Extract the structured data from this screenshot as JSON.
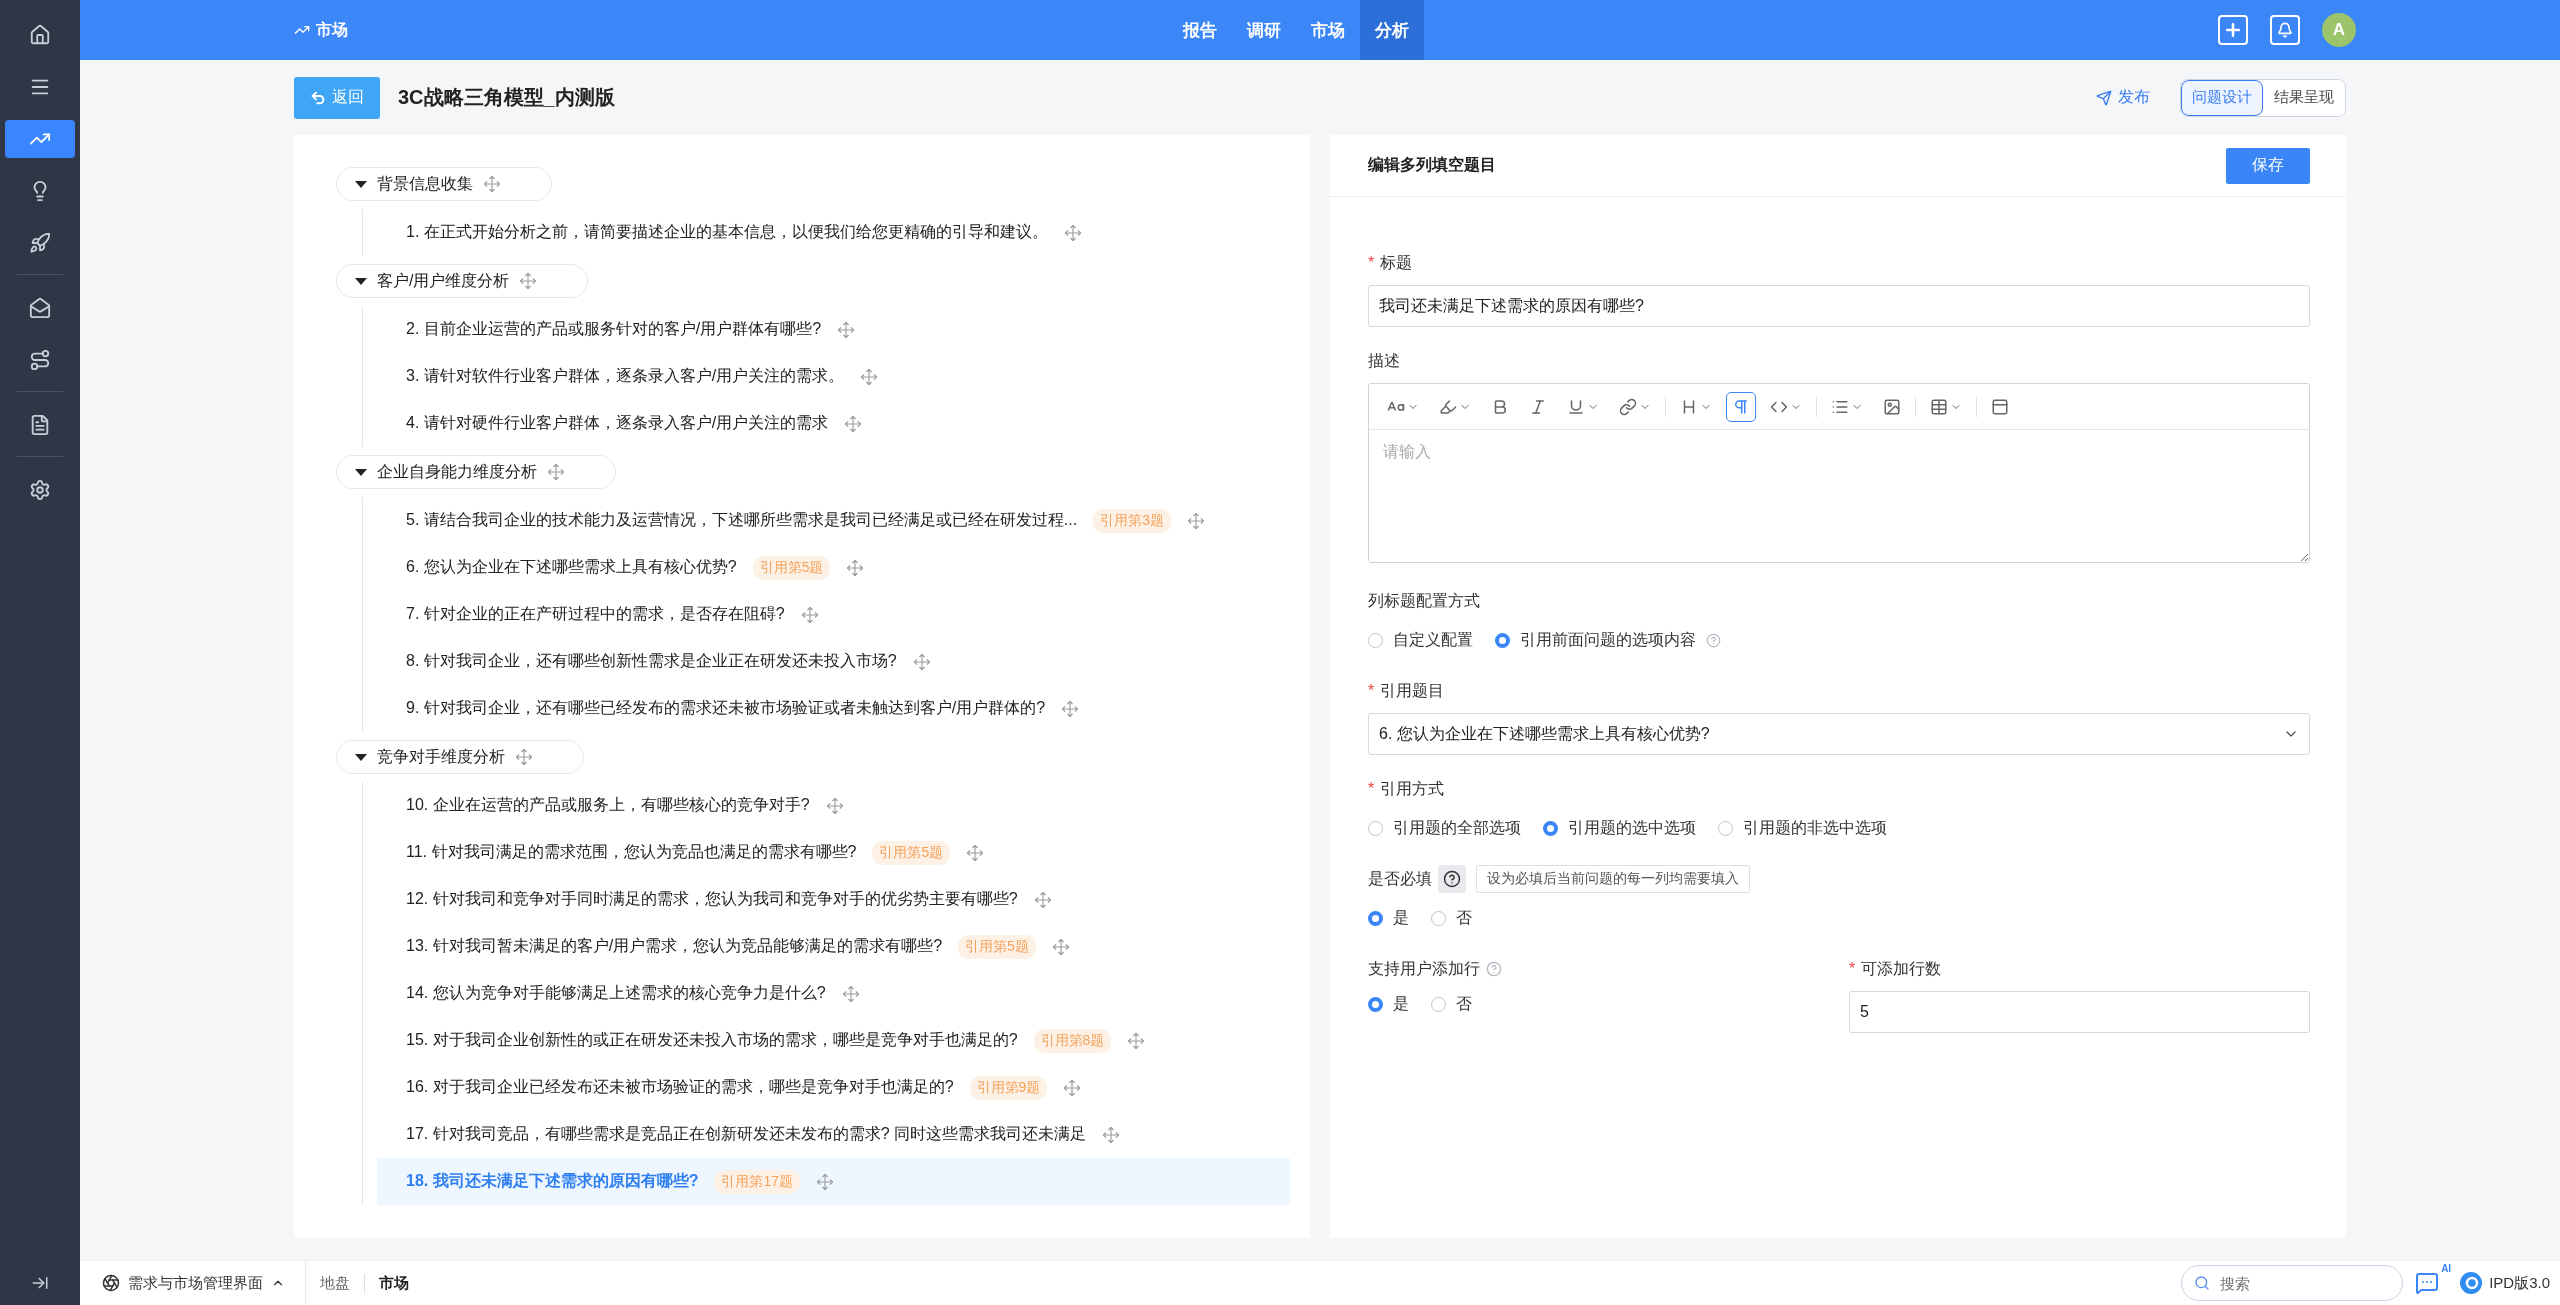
{
  "sidebar": {
    "groups": [
      [
        {
          "selected": false
        },
        {
          "selected": false
        },
        {
          "selected": true
        },
        {
          "selected": false
        },
        {
          "selected": false
        }
      ],
      [
        {
          "selected": false
        },
        {
          "selected": false
        }
      ],
      [
        {
          "selected": false
        }
      ],
      [
        {
          "selected": false
        }
      ]
    ]
  },
  "topbar": {
    "brand": "市场",
    "tabs": [
      {
        "label": "报告",
        "selected": false
      },
      {
        "label": "调研",
        "selected": false
      },
      {
        "label": "市场",
        "selected": false
      },
      {
        "label": "分析",
        "selected": true
      }
    ],
    "avatar": "A"
  },
  "header": {
    "back": "返回",
    "title": "3C战略三角模型_内测版",
    "publish": "发布",
    "views": [
      {
        "label": "问题设计",
        "selected": true
      },
      {
        "label": "结果呈现",
        "selected": false
      }
    ]
  },
  "outline": {
    "sections": [
      {
        "title": "背景信息收集",
        "expanded": true,
        "children": [
          {
            "text": "1. 在正式开始分析之前，请简要描述企业的基本信息，以便我们给您更精确的引导和建议。",
            "selected": false
          }
        ]
      },
      {
        "title": "客户/用户维度分析",
        "expanded": true,
        "children": [
          {
            "text": "2. 目前企业运营的产品或服务针对的客户/用户群体有哪些?",
            "selected": false
          },
          {
            "text": "3. 请针对软件行业客户群体，逐条录入客户/用户关注的需求。",
            "selected": false
          },
          {
            "text": "4. 请针对硬件行业客户群体，逐条录入客户/用户关注的需求",
            "selected": false
          }
        ]
      },
      {
        "title": "企业自身能力维度分析",
        "expanded": true,
        "children": [
          {
            "text": "5. 请结合我司企业的技术能力及运营情况，下述哪所些需求是我司已经满足或已经在研发过程...",
            "ref": "引用第3题",
            "selected": false
          },
          {
            "text": "6. 您认为企业在下述哪些需求上具有核心优势?",
            "ref": "引用第5题",
            "selected": false
          },
          {
            "text": "7. 针对企业的正在产研过程中的需求，是否存在阻碍?",
            "selected": false
          },
          {
            "text": "8. 针对我司企业，还有哪些创新性需求是企业正在研发还未投入市场?",
            "selected": false
          },
          {
            "text": "9. 针对我司企业，还有哪些已经发布的需求还未被市场验证或者未触达到客户/用户群体的?",
            "selected": false
          }
        ]
      },
      {
        "title": "竞争对手维度分析",
        "expanded": true,
        "children": [
          {
            "text": "10. 企业在运营的产品或服务上，有哪些核心的竞争对手?",
            "selected": false
          },
          {
            "text": "11. 针对我司满足的需求范围，您认为竞品也满足的需求有哪些?",
            "ref": "引用第5题",
            "selected": false
          },
          {
            "text": "12. 针对我司和竞争对手同时满足的需求，您认为我司和竞争对手的优劣势主要有哪些?",
            "selected": false
          },
          {
            "text": "13. 针对我司暂未满足的客户/用户需求，您认为竞品能够满足的需求有哪些?",
            "ref": "引用第5题",
            "selected": false
          },
          {
            "text": "14. 您认为竞争对手能够满足上述需求的核心竞争力是什么?",
            "selected": false
          },
          {
            "text": "15. 对于我司企业创新性的或正在研发还未投入市场的需求，哪些是竞争对手也满足的?",
            "ref": "引用第8题",
            "selected": false
          },
          {
            "text": "16. 对于我司企业已经发布还未被市场验证的需求，哪些是竞争对手也满足的?",
            "ref": "引用第9题",
            "selected": false
          },
          {
            "text": "17. 针对我司竞品，有哪些需求是竞品正在创新研发还未发布的需求? 同时这些需求我司还未满足",
            "selected": false
          },
          {
            "text": "18. 我司还未满足下述需求的原因有哪些?",
            "ref": "引用第17题",
            "selected": true
          }
        ]
      }
    ]
  },
  "form": {
    "heading": "编辑多列填空题目",
    "save": "保存",
    "title_field": {
      "label": "标题",
      "required_mark": "*",
      "value": "我司还未满足下述需求的原因有哪些?"
    },
    "description": {
      "label": "描述",
      "placeholder": "请输入",
      "toolbar": [
        {
          "active": false,
          "menu": true
        },
        {
          "active": false,
          "menu": true
        },
        {
          "active": false,
          "menu": false
        },
        {
          "active": false,
          "menu": false
        },
        {
          "active": false,
          "menu": true
        },
        {
          "active": false,
          "menu": true
        },
        {
          "active": false,
          "menu": true
        },
        {
          "active": true,
          "menu": false
        },
        {
          "active": false,
          "menu": true
        },
        {
          "active": false,
          "menu": true
        },
        {
          "active": false,
          "menu": false
        },
        {
          "active": false,
          "menu": true
        },
        {
          "active": false,
          "menu": false
        }
      ]
    },
    "column_mode": {
      "label": "列标题配置方式",
      "options": [
        {
          "label": "自定义配置",
          "selected": false,
          "help": false
        },
        {
          "label": "引用前面问题的选项内容",
          "selected": true,
          "help": true
        }
      ]
    },
    "ref_question": {
      "label": "引用题目",
      "required_mark": "*",
      "value": "6. 您认为企业在下述哪些需求上具有核心优势?"
    },
    "ref_mode": {
      "label": "引用方式",
      "required_mark": "*",
      "options": [
        {
          "label": "引用题的全部选项",
          "selected": false
        },
        {
          "label": "引用题的选中选项",
          "selected": true
        },
        {
          "label": "引用题的非选中选项",
          "selected": false
        }
      ]
    },
    "mandatory": {
      "label": "是否必填",
      "tooltip": "设为必填后当前问题的每一列均需要填入",
      "options": [
        {
          "label": "是",
          "selected": true
        },
        {
          "label": "否",
          "selected": false
        }
      ]
    },
    "add_rows": {
      "label": "支持用户添加行",
      "help": true,
      "options": [
        {
          "label": "是",
          "selected": true
        },
        {
          "label": "否",
          "selected": false
        }
      ]
    },
    "row_count": {
      "label": "可添加行数",
      "required_mark": "*",
      "value": "5"
    }
  },
  "bottombar": {
    "workspace": "需求与市场管理界面",
    "crumbs": [
      {
        "label": "地盘",
        "selected": false
      },
      {
        "label": "市场",
        "selected": true
      }
    ],
    "search": {
      "placeholder": "搜索"
    },
    "ai_badge": "AI",
    "version": "IPD版3.0"
  }
}
